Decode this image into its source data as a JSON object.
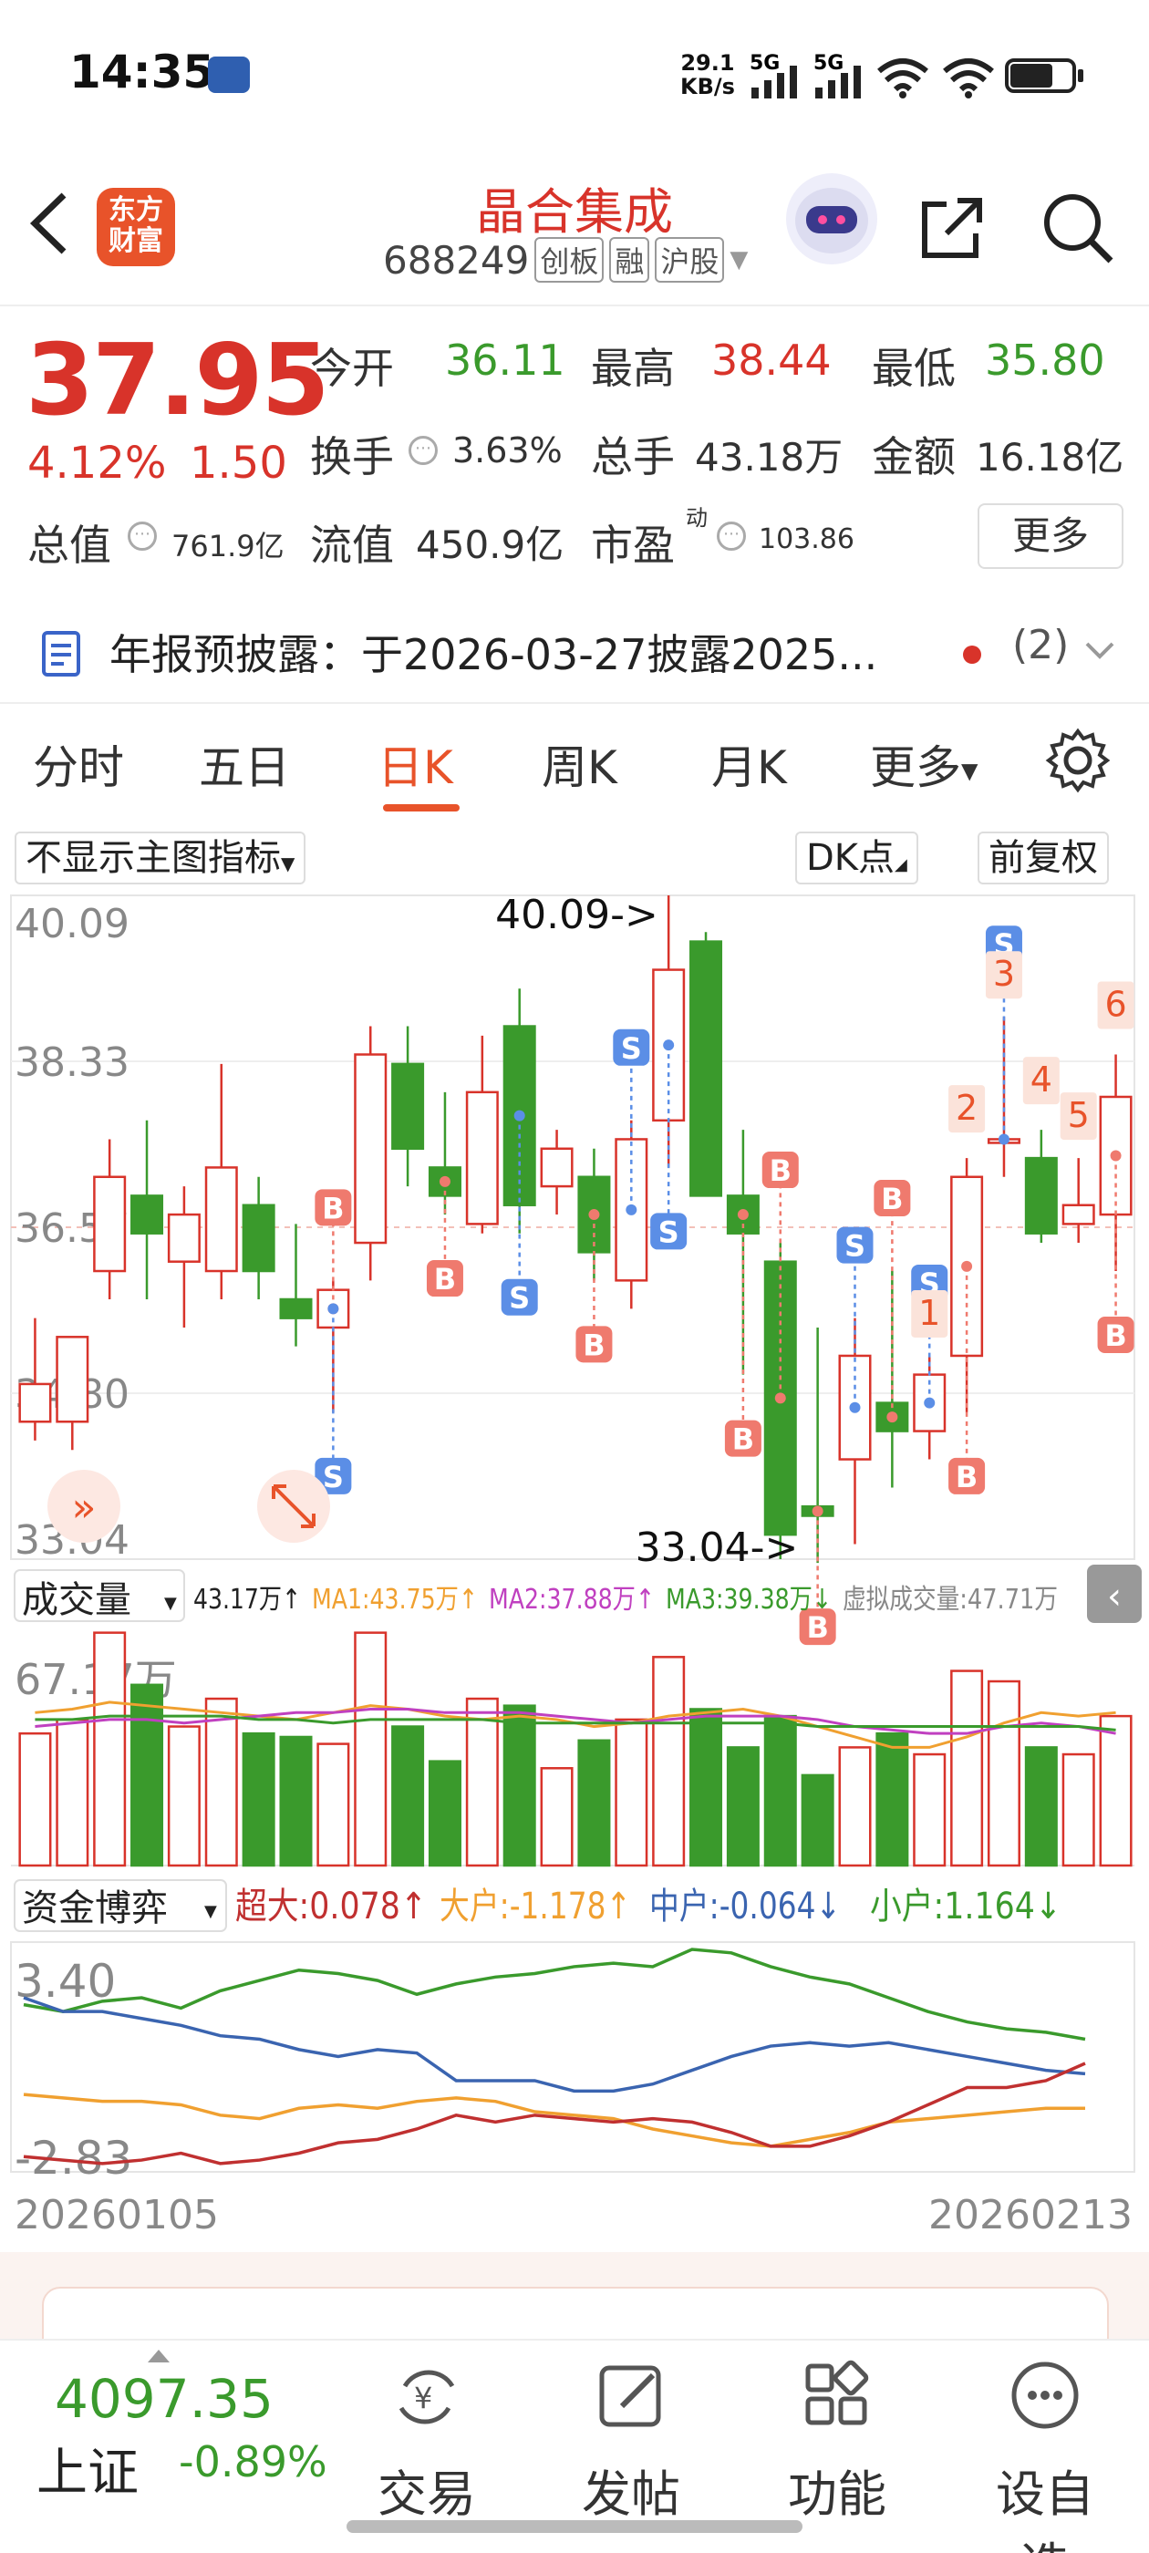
{
  "status": {
    "time": "14:35",
    "speed_value": "29.1",
    "speed_unit": "KB/s",
    "sig1": "5G",
    "sig2": "5G"
  },
  "header": {
    "brand_line1": "东方",
    "brand_line2": "财富",
    "stock_name": "晶合集成",
    "stock_code": "688249",
    "tags": [
      "创板",
      "融",
      "沪股"
    ]
  },
  "quote": {
    "price": "37.95",
    "change_pct": "4.12%",
    "change_val": "1.50",
    "open_label": "今开",
    "open": "36.11",
    "high_label": "最高",
    "high": "38.44",
    "low_label": "最低",
    "low": "35.80",
    "turnover_label": "换手",
    "turnover": "3.63%",
    "volume_label": "总手",
    "volume": "43.18万",
    "amount_label": "金额",
    "amount": "16.18亿",
    "mktcap_label": "总值",
    "mktcap": "761.9亿",
    "float_label": "流值",
    "float": "450.9亿",
    "pe_label": "市盈",
    "pe_sup": "动",
    "pe": "103.86",
    "more": "更多"
  },
  "notice": {
    "text": "年报预披露：于2026-03-27披露2025...",
    "count": "(2)"
  },
  "tabs": [
    "分时",
    "五日",
    "日K",
    "周K",
    "月K",
    "更多"
  ],
  "toolbar": {
    "indicator": "不显示主图指标",
    "dk": "DK点",
    "adjust": "前复权"
  },
  "chart_data": {
    "type": "candlestick",
    "ylim": [
      33.04,
      40.09
    ],
    "y_ticks": [
      "40.09",
      "38.33",
      "36.57",
      "34.80",
      "33.04"
    ],
    "max_label": "40.09->",
    "min_label": "33.04->",
    "x_start": "20260105",
    "x_end": "20260213",
    "candles": [
      {
        "o": 34.5,
        "h": 35.6,
        "l": 34.3,
        "c": 34.9
      },
      {
        "o": 34.5,
        "h": 35.2,
        "l": 34.2,
        "c": 35.4
      },
      {
        "o": 36.1,
        "h": 37.5,
        "l": 35.8,
        "c": 37.1
      },
      {
        "o": 36.9,
        "h": 37.7,
        "l": 35.8,
        "c": 36.5
      },
      {
        "o": 36.2,
        "h": 37.0,
        "l": 35.5,
        "c": 36.7
      },
      {
        "o": 36.1,
        "h": 38.3,
        "l": 35.8,
        "c": 37.2
      },
      {
        "o": 36.8,
        "h": 37.1,
        "l": 35.8,
        "c": 36.1
      },
      {
        "o": 35.8,
        "h": 36.6,
        "l": 35.3,
        "c": 35.6
      },
      {
        "o": 35.5,
        "h": 36.0,
        "l": 34.6,
        "c": 35.9
      },
      {
        "o": 36.4,
        "h": 38.7,
        "l": 36.0,
        "c": 38.4
      },
      {
        "o": 38.3,
        "h": 38.7,
        "l": 37.0,
        "c": 37.4
      },
      {
        "o": 37.2,
        "h": 38.0,
        "l": 36.7,
        "c": 36.9
      },
      {
        "o": 36.6,
        "h": 38.6,
        "l": 36.5,
        "c": 38.0
      },
      {
        "o": 38.7,
        "h": 39.1,
        "l": 36.5,
        "c": 36.8
      },
      {
        "o": 37.0,
        "h": 37.6,
        "l": 36.7,
        "c": 37.4
      },
      {
        "o": 37.1,
        "h": 37.4,
        "l": 36.0,
        "c": 36.3
      },
      {
        "o": 36.0,
        "h": 37.7,
        "l": 35.7,
        "c": 37.5
      },
      {
        "o": 37.7,
        "h": 40.09,
        "l": 37.2,
        "c": 39.3
      },
      {
        "o": 39.6,
        "h": 39.7,
        "l": 36.9,
        "c": 36.9
      },
      {
        "o": 36.9,
        "h": 37.6,
        "l": 35.0,
        "c": 36.5
      },
      {
        "o": 36.2,
        "h": 36.4,
        "l": 33.04,
        "c": 33.3
      },
      {
        "o": 33.6,
        "h": 35.5,
        "l": 33.0,
        "c": 33.5
      },
      {
        "o": 34.1,
        "h": 35.6,
        "l": 33.2,
        "c": 35.2
      },
      {
        "o": 34.7,
        "h": 36.1,
        "l": 33.8,
        "c": 34.4
      },
      {
        "o": 34.4,
        "h": 35.2,
        "l": 34.1,
        "c": 35.0
      },
      {
        "o": 35.2,
        "h": 37.3,
        "l": 34.6,
        "c": 37.1
      },
      {
        "o": 37.5,
        "h": 38.8,
        "l": 37.1,
        "c": 37.5
      },
      {
        "o": 37.3,
        "h": 37.6,
        "l": 36.4,
        "c": 36.5
      },
      {
        "o": 36.6,
        "h": 37.3,
        "l": 36.4,
        "c": 36.8
      },
      {
        "o": 36.7,
        "h": 38.4,
        "l": 36.1,
        "c": 37.95
      }
    ],
    "markers": [
      {
        "i": 8,
        "t": "B",
        "pos": "above"
      },
      {
        "i": 8,
        "t": "S",
        "pos": "below"
      },
      {
        "i": 11,
        "t": "B",
        "pos": "below"
      },
      {
        "i": 13,
        "t": "S",
        "pos": "below"
      },
      {
        "i": 15,
        "t": "B",
        "pos": "below"
      },
      {
        "i": 16,
        "t": "S",
        "pos": "above"
      },
      {
        "i": 17,
        "t": "S",
        "pos": "below"
      },
      {
        "i": 19,
        "t": "B",
        "pos": "below"
      },
      {
        "i": 20,
        "t": "B",
        "pos": "above"
      },
      {
        "i": 21,
        "t": "B",
        "pos": "below"
      },
      {
        "i": 22,
        "t": "S",
        "pos": "above"
      },
      {
        "i": 23,
        "t": "B",
        "pos": "above"
      },
      {
        "i": 24,
        "t": "S",
        "pos": "above"
      },
      {
        "i": 25,
        "t": "B",
        "pos": "below"
      },
      {
        "i": 26,
        "t": "S",
        "pos": "above"
      },
      {
        "i": 29,
        "t": "B",
        "pos": "below"
      }
    ],
    "dk_numbers": [
      {
        "i": 24,
        "n": "1"
      },
      {
        "i": 25,
        "n": "2"
      },
      {
        "i": 26,
        "n": "3"
      },
      {
        "i": 27,
        "n": "4"
      },
      {
        "i": 28,
        "n": "5"
      },
      {
        "i": 29,
        "n": "6"
      }
    ]
  },
  "volume": {
    "title": "成交量",
    "current": "43.17万",
    "ma1": "MA1:43.75万",
    "ma2": "MA2:37.88万",
    "ma3": "MA3:39.38万",
    "virtual": "虚拟成交量:47.71万",
    "max_label": "67.17万",
    "ymax": 67.17,
    "bars": [
      38,
      42,
      67,
      52,
      40,
      48,
      38,
      37,
      35,
      67,
      40,
      30,
      48,
      46,
      28,
      36,
      42,
      60,
      45,
      34,
      43,
      26,
      34,
      38,
      32,
      56,
      53,
      34,
      32,
      43
    ],
    "ma_lines": {
      "ma1": [
        44,
        45,
        47,
        46,
        45,
        44,
        43,
        42,
        44,
        46,
        45,
        43,
        42,
        43,
        42,
        40,
        41,
        43,
        44,
        45,
        43,
        40,
        37,
        34,
        34,
        37,
        41,
        44,
        43,
        44
      ],
      "ma2": [
        40,
        41,
        42,
        42,
        41,
        42,
        43,
        44,
        44,
        45,
        45,
        44,
        44,
        44,
        43,
        42,
        41,
        42,
        43,
        43,
        43,
        42,
        40,
        39,
        38,
        38,
        40,
        41,
        40,
        38
      ],
      "ma3": [
        42,
        42,
        43,
        43,
        43,
        43,
        42,
        42,
        41,
        42,
        42,
        42,
        42,
        41,
        41,
        41,
        41,
        41,
        41,
        41,
        41,
        40,
        40,
        40,
        40,
        40,
        40,
        40,
        40,
        39
      ]
    }
  },
  "capital_flow": {
    "title": "资金博弈",
    "super_large": "超大:0.078",
    "large": "大户:-1.178",
    "medium": "中户:-0.064",
    "small": "小户:1.164",
    "y_top": "3.40",
    "y_bottom": "-2.83",
    "ylim": [
      -2.83,
      3.4
    ],
    "series": {
      "small": [
        1.8,
        1.6,
        1.9,
        2.0,
        1.7,
        2.2,
        2.5,
        2.8,
        2.7,
        2.5,
        2.1,
        2.4,
        2.6,
        2.7,
        2.9,
        3.0,
        2.9,
        3.4,
        3.3,
        2.9,
        2.6,
        2.4,
        2.0,
        1.6,
        1.3,
        1.1,
        1.0,
        0.8
      ],
      "medium": [
        2.0,
        1.6,
        1.6,
        1.4,
        1.2,
        0.9,
        0.8,
        0.5,
        0.3,
        0.5,
        0.4,
        -0.4,
        -0.4,
        -0.4,
        -0.7,
        -0.7,
        -0.5,
        -0.1,
        0.3,
        0.6,
        0.7,
        0.6,
        0.7,
        0.5,
        0.3,
        0.1,
        -0.1,
        -0.2
      ],
      "large": [
        -0.8,
        -0.9,
        -1.0,
        -1.0,
        -1.1,
        -1.4,
        -1.5,
        -1.2,
        -1.1,
        -1.2,
        -1.0,
        -0.9,
        -1.0,
        -1.3,
        -1.4,
        -1.5,
        -1.8,
        -2.0,
        -2.2,
        -2.3,
        -2.1,
        -1.9,
        -1.6,
        -1.5,
        -1.4,
        -1.3,
        -1.2,
        -1.2
      ],
      "super_large": [
        -2.6,
        -2.7,
        -2.8,
        -2.7,
        -2.5,
        -2.8,
        -2.7,
        -2.5,
        -2.2,
        -2.1,
        -1.8,
        -1.4,
        -1.6,
        -1.4,
        -1.5,
        -1.6,
        -1.5,
        -1.6,
        -1.9,
        -2.3,
        -2.3,
        -2.0,
        -1.6,
        -1.1,
        -0.6,
        -0.6,
        -0.4,
        0.1
      ]
    }
  },
  "bottom": {
    "index_value": "4097.35",
    "index_name": "上证",
    "index_change": "-0.89%",
    "nav": [
      "交易",
      "发帖",
      "功能",
      "设自选"
    ]
  },
  "colors": {
    "up": "#d8332a",
    "down": "#3a9a2c",
    "accent": "#e8532a",
    "ma1": "#f0a030",
    "ma2": "#c040c0",
    "ma3": "#3a9a2c",
    "marker_b": "#ef7a6e",
    "marker_s": "#5b8ee6"
  }
}
